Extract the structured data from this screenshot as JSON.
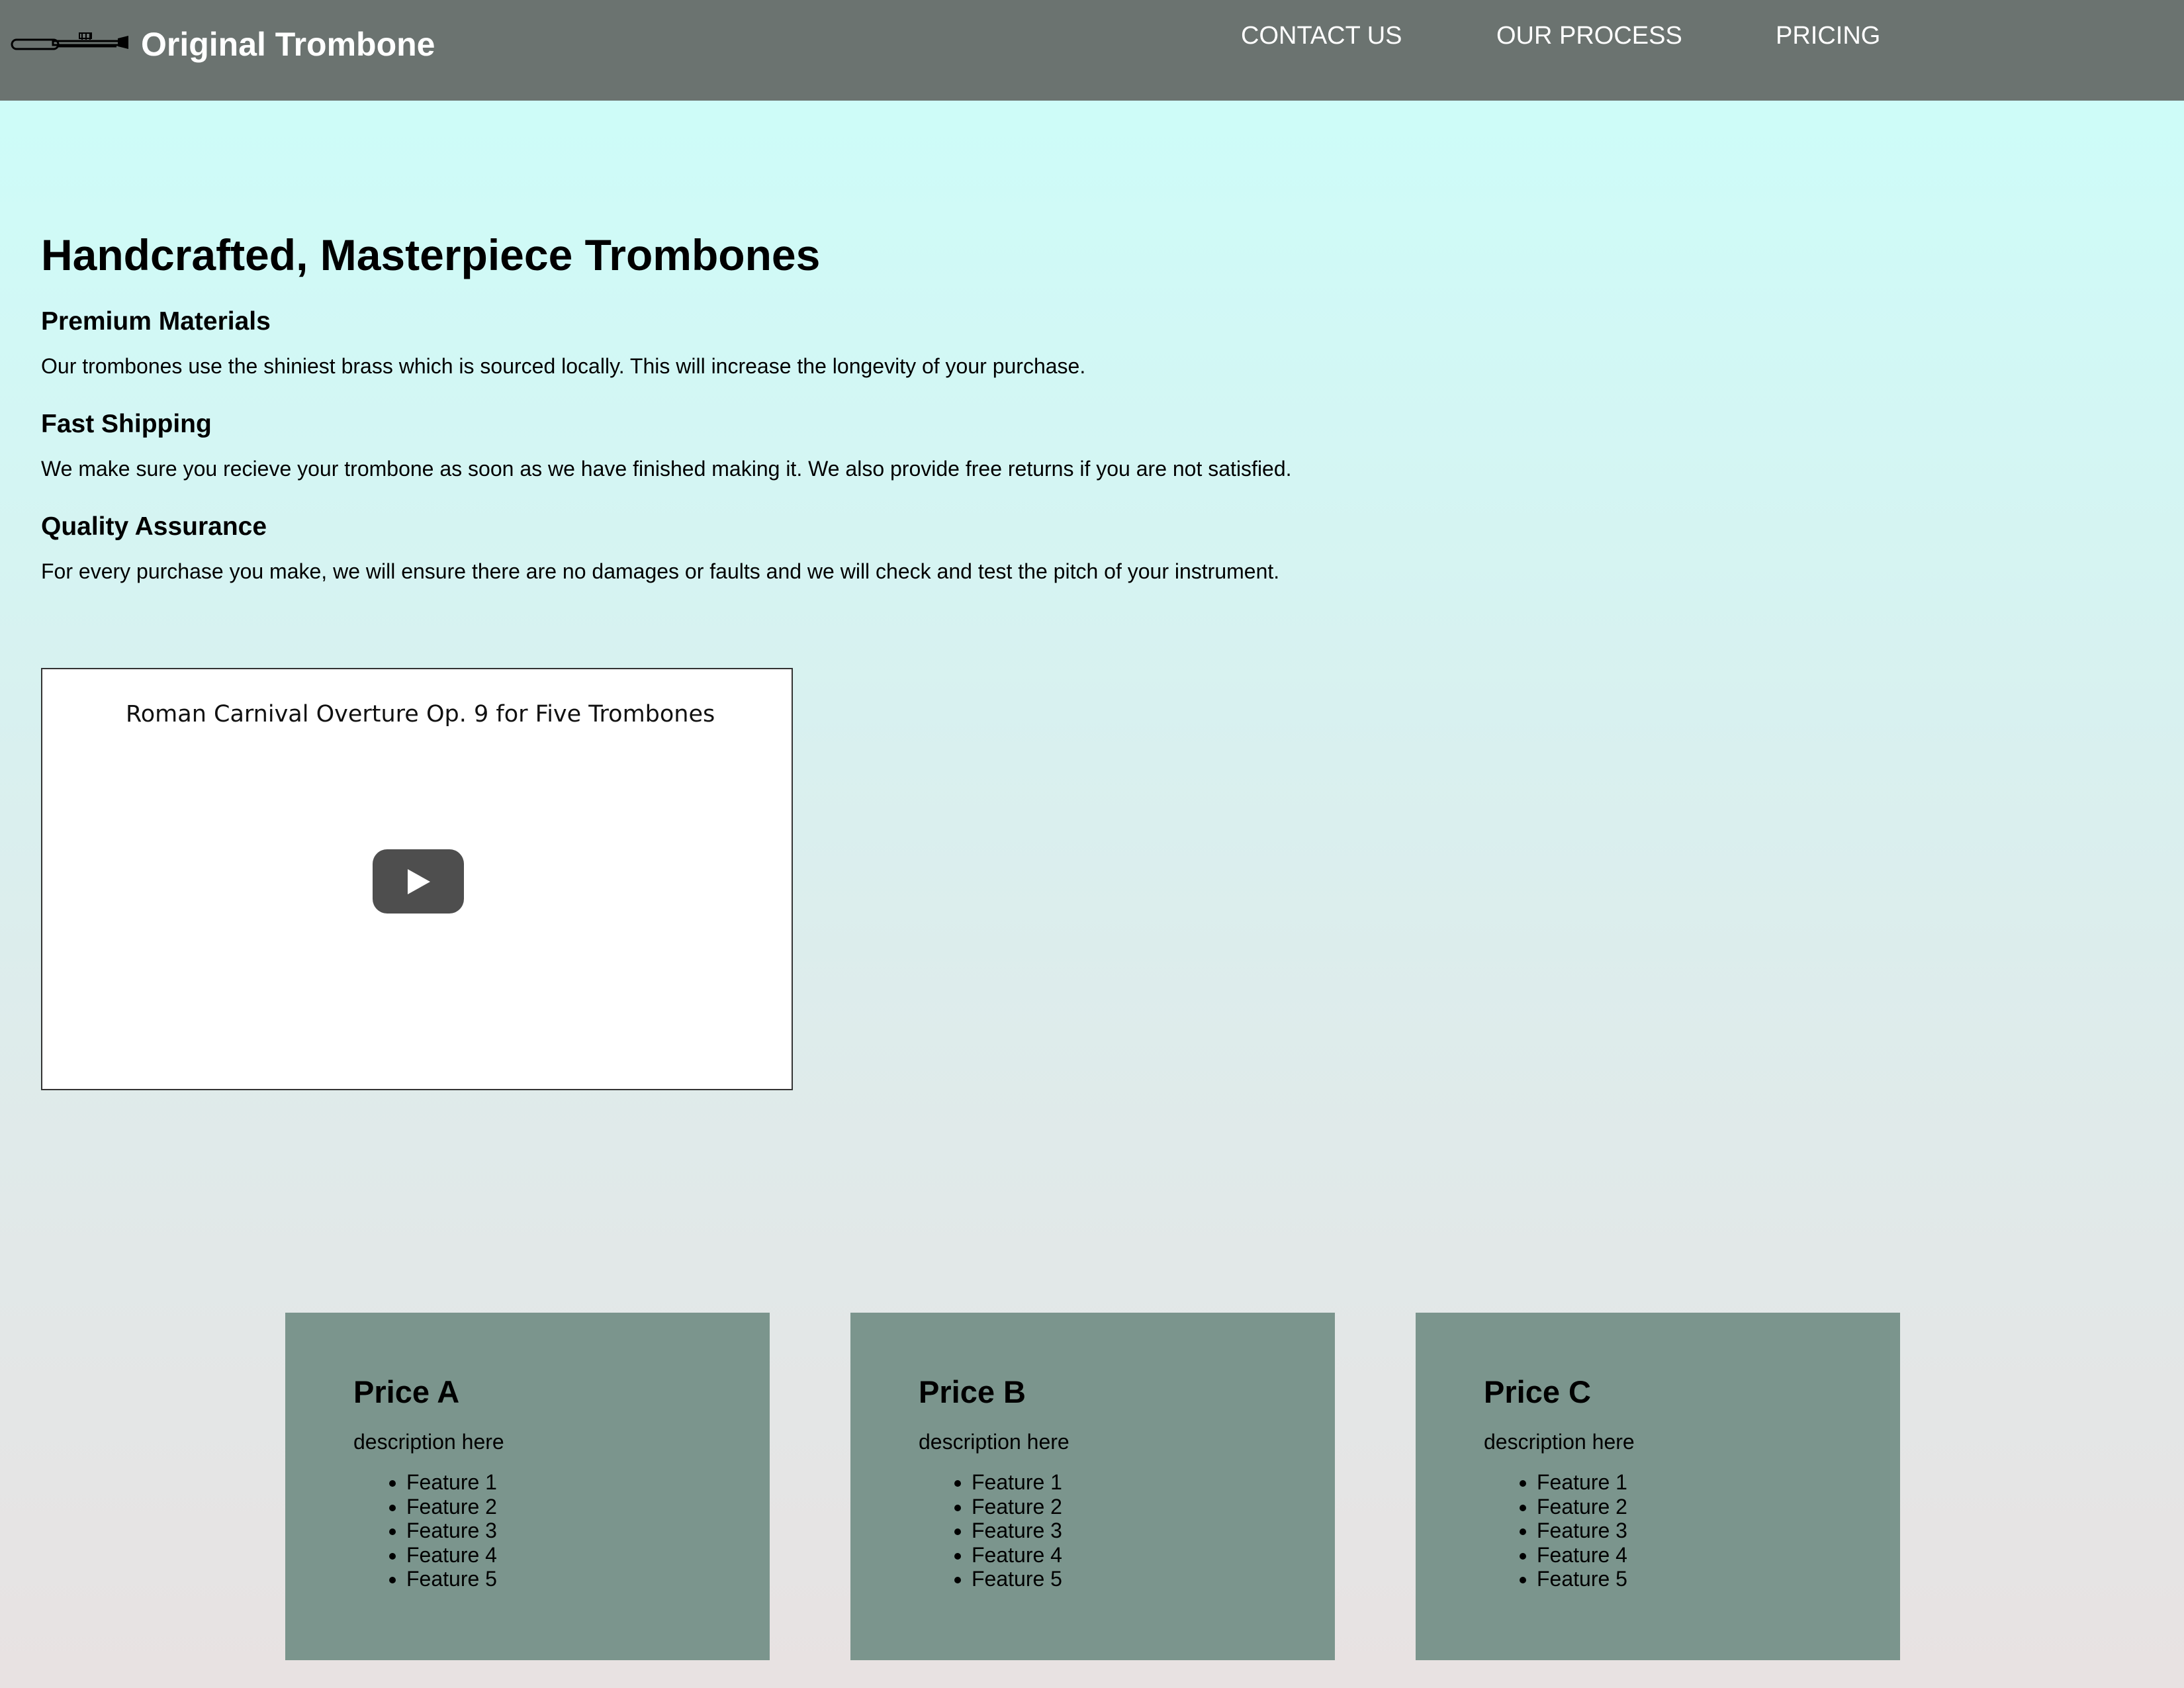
{
  "header": {
    "brand": "Original Trombone",
    "logo_icon": "trombone-icon",
    "background": "#6b7370",
    "nav": [
      {
        "label": "CONTACT US"
      },
      {
        "label": "OUR PROCESS"
      },
      {
        "label": "PRICING"
      }
    ]
  },
  "main": {
    "title": "Handcrafted, Masterpiece Trombones",
    "features": [
      {
        "heading": "Premium Materials",
        "text": "Our trombones use the shiniest brass which is sourced locally. This will increase the longevity of your purchase."
      },
      {
        "heading": "Fast Shipping",
        "text": "We make sure you recieve your trombone as soon as we have finished making it. We also provide free returns if you are not satisfied."
      },
      {
        "heading": "Quality Assurance",
        "text": "For every purchase you make, we will ensure there are no damages or faults and we will check and test the pitch of your instrument."
      }
    ]
  },
  "video": {
    "title": "Roman Carnival Overture Op. 9 for Five Trombones",
    "play_icon": "play-icon"
  },
  "pricing": {
    "card_color": "#7b958d",
    "plans": [
      {
        "title": "Price A",
        "description": "description here",
        "features": [
          "Feature 1",
          "Feature 2",
          "Feature 3",
          "Feature 4",
          "Feature 5"
        ]
      },
      {
        "title": "Price B",
        "description": "description here",
        "features": [
          "Feature 1",
          "Feature 2",
          "Feature 3",
          "Feature 4",
          "Feature 5"
        ]
      },
      {
        "title": "Price C",
        "description": "description here",
        "features": [
          "Feature 1",
          "Feature 2",
          "Feature 3",
          "Feature 4",
          "Feature 5"
        ]
      }
    ]
  }
}
